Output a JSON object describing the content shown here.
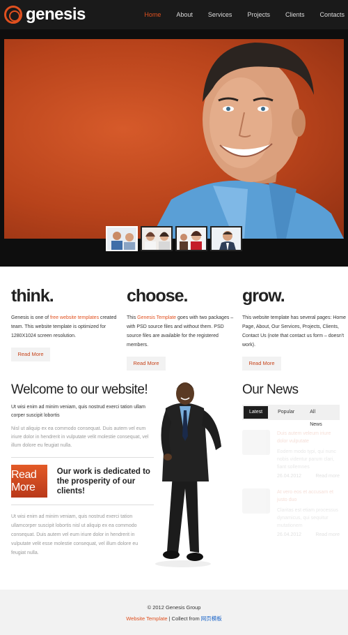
{
  "header": {
    "logo_text": "genesis",
    "nav": [
      "Home",
      "About",
      "Services",
      "Projects",
      "Clients",
      "Contacts"
    ],
    "active_nav": "Home"
  },
  "hero": {
    "thumbnails": [
      "team-photo",
      "women-photo",
      "call-center-photo",
      "businessman-photo"
    ]
  },
  "columns": [
    {
      "title": "think.",
      "text_before": "Genesis is one of ",
      "highlight": "free website templates",
      "text_after": " created team. This website template is optimized for 1280X1024 screen resolution.",
      "button": "Read More"
    },
    {
      "title": "choose.",
      "text_before": "This ",
      "highlight": "Genesis Template",
      "text_after": " goes with two packages – with PSD source files and without them. PSD source files are available for the registered members.",
      "button": "Read More"
    },
    {
      "title": "grow.",
      "text_before": "This website template has several pages: Home Page, About, Our Services, Projects, Clients, Contact Us (note that contact us form – doesn't work).",
      "highlight": "",
      "text_after": "",
      "button": "Read More"
    }
  ],
  "welcome": {
    "title": "Welcome to our website!",
    "p1": "Ut wisi enim ad minim veniam, quis nostrud exerci tation ullam corper suscipit lobortis",
    "p2": "Nisl ut aliquip ex ea commodo consequat. Duis autem vel eum iriure dolor in hendrerit in vulputate velit molestie consequat, vel illum dolore eu feugiat nulla.",
    "button": "Read More",
    "promo": "Our work is dedicated to the prosperity of our clients!",
    "p3": "Ut wisi enim ad minim veniam, quis nostrud exerci tation ullamcorper suscipit lobortis nisl ut aliquip ex ea commodo consequat. Duis autem vel eum iriure dolor in hendrerit in vulputate velit esse molestie consequat, vel illum dolore eu feugiat nulla."
  },
  "news": {
    "title": "Our News",
    "tabs": [
      "Latest",
      "Popular",
      "All News"
    ],
    "active_tab": "Latest",
    "items": [
      {
        "title": "Duis autem veleum iriure dolor vulputate",
        "text": "Eodem modo typi, qui nunc nobis videntur parum clari, fiant sollemnes",
        "date": "26.04.2012",
        "more": "Read more"
      },
      {
        "title": "At vero eos et accusam et justo duo",
        "text": "Claritas est etiam processus dynamicus, qui sequitur mutationem",
        "date": "26.04.2012",
        "more": "Read more"
      }
    ]
  },
  "footer": {
    "copyright": "© 2012 Genesis Group",
    "link_template": "Website Template",
    "separator": " | Collect from ",
    "link_site": "网页模板"
  },
  "colors": {
    "accent": "#e0501f",
    "header_bg": "#1a1a1a",
    "link_blue": "#1a64c8"
  }
}
